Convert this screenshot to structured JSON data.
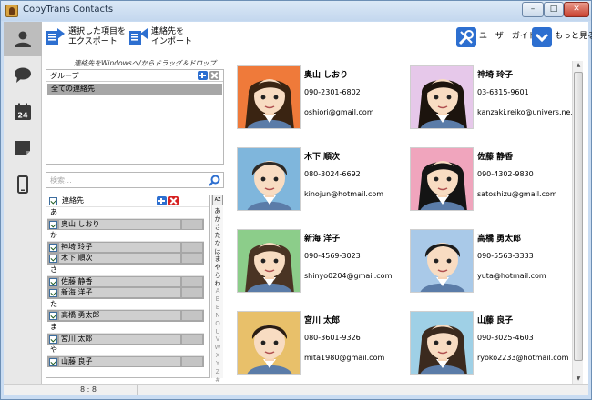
{
  "window": {
    "title": "CopyTrans Contacts",
    "minimize": "–",
    "maximize": "□",
    "close": "✕"
  },
  "sidebar": {
    "items": [
      {
        "icon": "contacts-icon"
      },
      {
        "icon": "messages-icon"
      },
      {
        "icon": "calendar-icon",
        "calendar_day": "24"
      },
      {
        "icon": "notes-icon"
      },
      {
        "icon": "phone-icon"
      }
    ]
  },
  "toolbar": {
    "export_label_1": "選択した項目を",
    "export_label_2": "エクスポート",
    "import_label_1": "連絡先を",
    "import_label_2": "インポート",
    "guide_label": "ユーザーガイド",
    "more_label": "もっと見る"
  },
  "drag_hint": "連絡先をWindowsへ/からドラッグ＆ドロップ",
  "groups": {
    "header": "グループ",
    "items": [
      "全ての連絡先"
    ]
  },
  "search": {
    "placeholder": "検索..."
  },
  "contact_list": {
    "header": "連絡先",
    "rows": [
      {
        "type": "section",
        "label": "あ"
      },
      {
        "type": "contact",
        "label": "奥山 しおり"
      },
      {
        "type": "section",
        "label": "か"
      },
      {
        "type": "contact",
        "label": "神埼 玲子"
      },
      {
        "type": "contact",
        "label": "木下 順次"
      },
      {
        "type": "section",
        "label": "さ"
      },
      {
        "type": "contact",
        "label": "佐藤 静香"
      },
      {
        "type": "contact",
        "label": "新海 洋子"
      },
      {
        "type": "section",
        "label": "た"
      },
      {
        "type": "contact",
        "label": "高橋 勇太郎"
      },
      {
        "type": "section",
        "label": "ま"
      },
      {
        "type": "contact",
        "label": "宮川 太郎"
      },
      {
        "type": "section",
        "label": "や"
      },
      {
        "type": "contact",
        "label": "山藤 良子"
      }
    ]
  },
  "az_index": {
    "top_label": "AZ",
    "kana": [
      "あ",
      "か",
      "さ",
      "た",
      "な",
      "は",
      "ま",
      "や",
      "ら",
      "わ"
    ],
    "latin": [
      "A",
      "B",
      "E",
      "N",
      "O",
      "U",
      "V",
      "W",
      "X",
      "Y",
      "Z",
      "#"
    ]
  },
  "contacts": [
    {
      "name": "奥山 しおり",
      "phone": "090-2301-6802",
      "email": "oshiori@gmail.com",
      "avatar": {
        "icon": "female-avatar-icon",
        "bg": "#ef7a3a",
        "hair": "#3a2412"
      }
    },
    {
      "name": "神埼 玲子",
      "phone": "03-6315-9601",
      "email": "kanzaki.reiko@univers.ne.jp",
      "avatar": {
        "icon": "female-avatar-icon",
        "bg": "#e6c8ea",
        "hair": "#1c140e"
      }
    },
    {
      "name": "木下 順次",
      "phone": "080-3024-6692",
      "email": "kinojun@hotmail.com",
      "avatar": {
        "icon": "male-avatar-icon",
        "bg": "#7fb6dc",
        "hair": "#2e2a26"
      }
    },
    {
      "name": "佐藤 静香",
      "phone": "090-4302-9830",
      "email": "satoshizu@gmail.com",
      "avatar": {
        "icon": "female-avatar-icon",
        "bg": "#f0a5bd",
        "hair": "#141414"
      }
    },
    {
      "name": "新海 洋子",
      "phone": "090-4569-3023",
      "email": "shinyo0204@gmail.com",
      "avatar": {
        "icon": "female-avatar-icon",
        "bg": "#8ccd8a",
        "hair": "#4a3424"
      }
    },
    {
      "name": "高橋 勇太郎",
      "phone": "090-5563-3333",
      "email": "yuta@hotmail.com",
      "avatar": {
        "icon": "male-avatar-icon",
        "bg": "#a9c9e8",
        "hair": "#1b1b1b"
      }
    },
    {
      "name": "宮川 太郎",
      "phone": "080-3601-9326",
      "email": "mita1980@gmail.com",
      "avatar": {
        "icon": "male-avatar-icon",
        "bg": "#e8c06a",
        "hair": "#2a1d14"
      }
    },
    {
      "name": "山藤 良子",
      "phone": "090-3025-4603",
      "email": "ryoko2233@hotmail.com",
      "avatar": {
        "icon": "female-avatar-icon",
        "bg": "#9fd0e6",
        "hair": "#3b2a1e"
      }
    }
  ],
  "status": {
    "count": "8 : 8"
  }
}
